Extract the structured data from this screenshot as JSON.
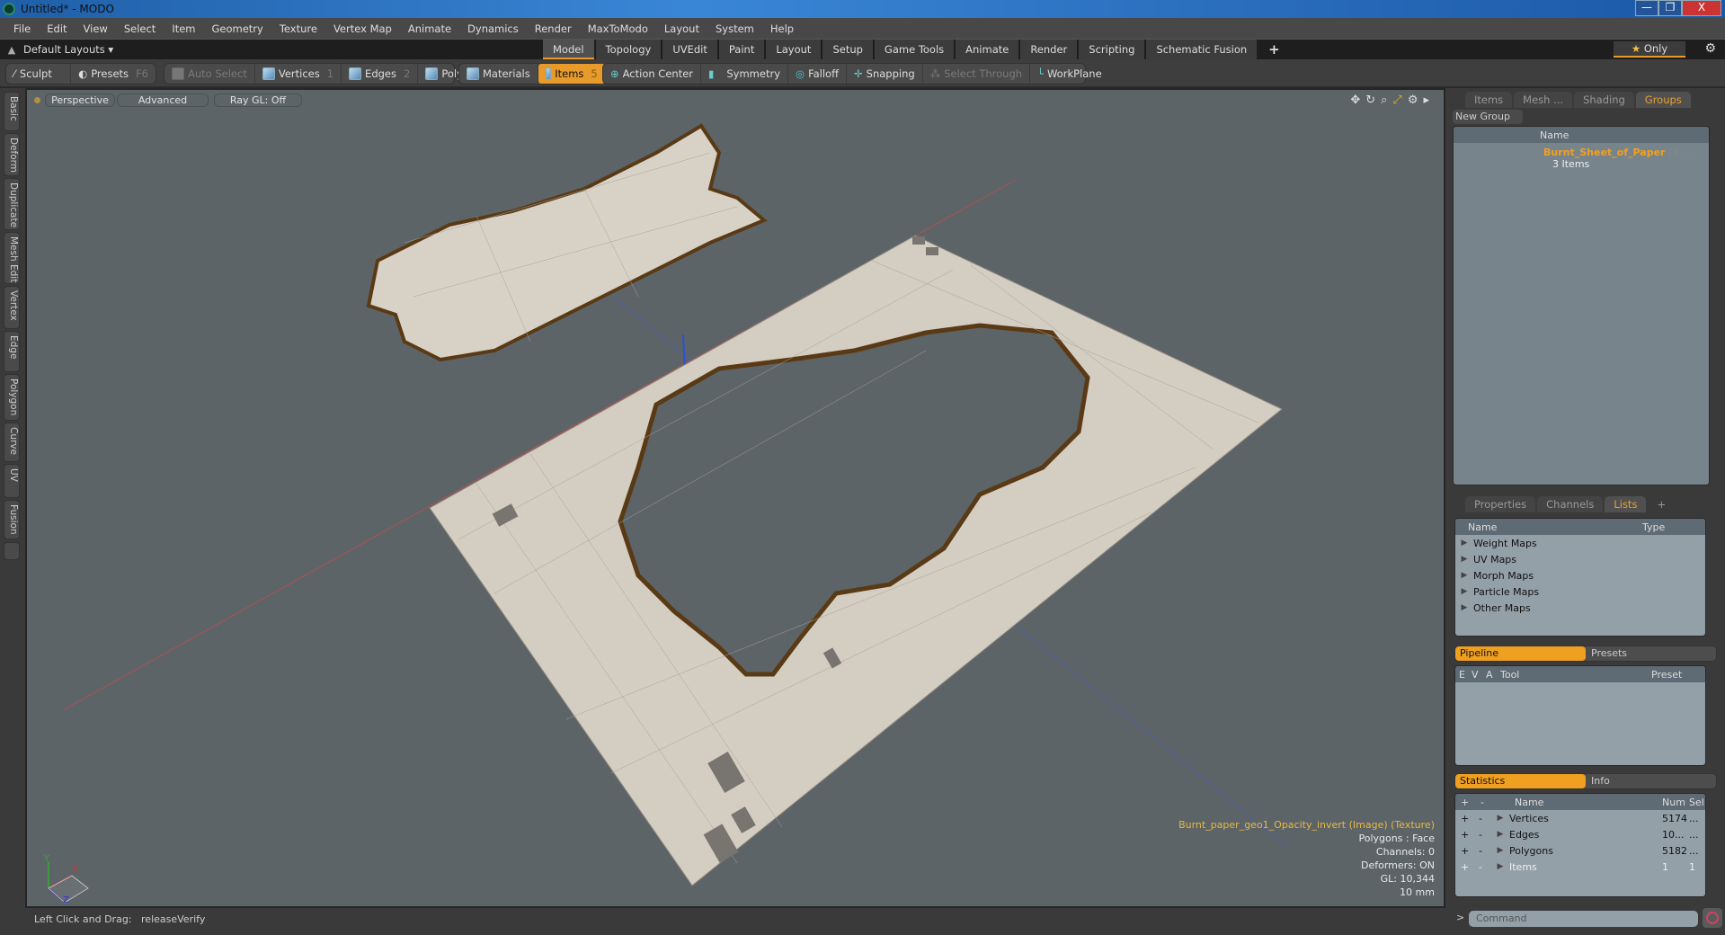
{
  "window": {
    "title": "Untitled* - MODO",
    "min": "—",
    "max": "❐",
    "close": "X"
  },
  "menu": [
    "File",
    "Edit",
    "View",
    "Select",
    "Item",
    "Geometry",
    "Texture",
    "Vertex Map",
    "Animate",
    "Dynamics",
    "Render",
    "MaxToModo",
    "Layout",
    "System",
    "Help"
  ],
  "layoutbar": {
    "layout_label": "Default Layouts ▾",
    "tabs": [
      "Model",
      "Topology",
      "UVEdit",
      "Paint",
      "Layout",
      "Setup",
      "Game Tools",
      "Animate",
      "Render",
      "Scripting",
      "Schematic Fusion"
    ],
    "active_tab": "Model",
    "add": "+",
    "only_label": "Only"
  },
  "toolbar": {
    "sculpt": "Sculpt",
    "presets": "Presets",
    "presets_key": "F6",
    "auto_select": "Auto Select",
    "vertices": "Vertices",
    "vertices_key": "1",
    "edges": "Edges",
    "edges_key": "2",
    "polygons": "Polygons",
    "materials": "Materials",
    "items": "Items",
    "items_key": "5",
    "action_center": "Action Center",
    "symmetry": "Symmetry",
    "falloff": "Falloff",
    "snapping": "Snapping",
    "select_through": "Select Through",
    "workplane": "WorkPlane"
  },
  "side_tabs": [
    "Basic",
    "Deform",
    "Duplicate",
    "Mesh Edit",
    "Vertex",
    "Edge",
    "Polygon",
    "Curve",
    "UV",
    "Fusion"
  ],
  "viewport": {
    "view": "Perspective",
    "shading": "Advanced",
    "raygl": "Ray GL: Off",
    "info": {
      "texture": "Burnt_paper_geo1_Opacity_invert (Image) (Texture)",
      "polygons": "Polygons : Face",
      "channels": "Channels: 0",
      "deformers": "Deformers: ON",
      "gl": "GL: 10,344",
      "scale": "10 mm"
    },
    "axis": {
      "x": "X",
      "y": "Y",
      "z": "Z"
    }
  },
  "status": {
    "hint": "Left Click and Drag:",
    "action": "releaseVerify"
  },
  "groups_panel": {
    "tabs": [
      "Items",
      "Mesh ...",
      "Shading",
      "Groups"
    ],
    "active": "Groups",
    "new_group": "New Group",
    "name_col": "Name",
    "group_name": "Burnt_Sheet_of_Paper",
    "group_count_suffix": "(3 ...",
    "group_sub": "3 Items"
  },
  "lists_panel": {
    "tabs": [
      "Properties",
      "Channels",
      "Lists"
    ],
    "active": "Lists",
    "add": "+",
    "cols": [
      "Name",
      "Type"
    ],
    "rows": [
      "Weight Maps",
      "UV Maps",
      "Morph Maps",
      "Particle Maps",
      "Other Maps"
    ]
  },
  "pipeline_panel": {
    "tabs": [
      "Pipeline",
      "Presets"
    ],
    "cols": [
      "E",
      "V",
      "A",
      "Tool",
      "Preset"
    ]
  },
  "stats_panel": {
    "tabs": [
      "Statistics",
      "Info"
    ],
    "cols": [
      "+",
      "-",
      "Name",
      "Num",
      "Sel"
    ],
    "rows": [
      {
        "name": "Vertices",
        "num": "5174",
        "sel": "..."
      },
      {
        "name": "Edges",
        "num": "10...",
        "sel": "..."
      },
      {
        "name": "Polygons",
        "num": "5182",
        "sel": "..."
      },
      {
        "name": "Items",
        "num": "1",
        "sel": "1"
      }
    ]
  },
  "command": {
    "placeholder": "Command",
    "prompt": ">"
  }
}
